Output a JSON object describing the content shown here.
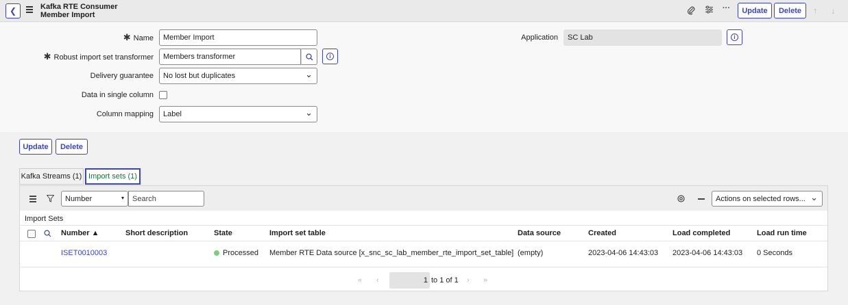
{
  "header": {
    "title_line1": "Kafka RTE Consumer",
    "title_line2": "Member Import",
    "update_label": "Update",
    "delete_label": "Delete",
    "more_label": "···"
  },
  "form": {
    "name_label": "Name",
    "name_value": "Member Import",
    "transformer_label": "Robust import set transformer",
    "transformer_value": "Members transformer",
    "delivery_label": "Delivery guarantee",
    "delivery_value": "No lost but duplicates",
    "single_column_label": "Data in single column",
    "column_mapping_label": "Column mapping",
    "column_mapping_value": "Label",
    "application_label": "Application",
    "application_value": "SC Lab"
  },
  "actions": {
    "update_label": "Update",
    "delete_label": "Delete"
  },
  "tabs": [
    {
      "label": "Kafka Streams (1)",
      "active": false
    },
    {
      "label": "Import sets (1)",
      "active": true
    }
  ],
  "list": {
    "filter_field": "Number",
    "search_placeholder": "Search",
    "actions_select": "Actions on selected rows...",
    "caption": "Import Sets",
    "columns": [
      "Number ▲",
      "Short description",
      "State",
      "Import set table",
      "Data source",
      "Created",
      "Load completed",
      "Load run time"
    ],
    "rows": [
      {
        "number": "ISET0010003",
        "short_description": "",
        "state": "Processed",
        "import_set_table": "Member RTE Data source [x_snc_sc_lab_member_rte_import_set_table]",
        "data_source": "(empty)",
        "created": "2023-04-06 14:43:03",
        "load_completed": "2023-04-06 14:43:03",
        "load_run_time": "0 Seconds"
      }
    ],
    "pager": {
      "current_page": "1",
      "range_text": "to 1 of 1"
    }
  },
  "colors": {
    "accent": "#3b44c4",
    "state_processed": "#78d17a"
  }
}
